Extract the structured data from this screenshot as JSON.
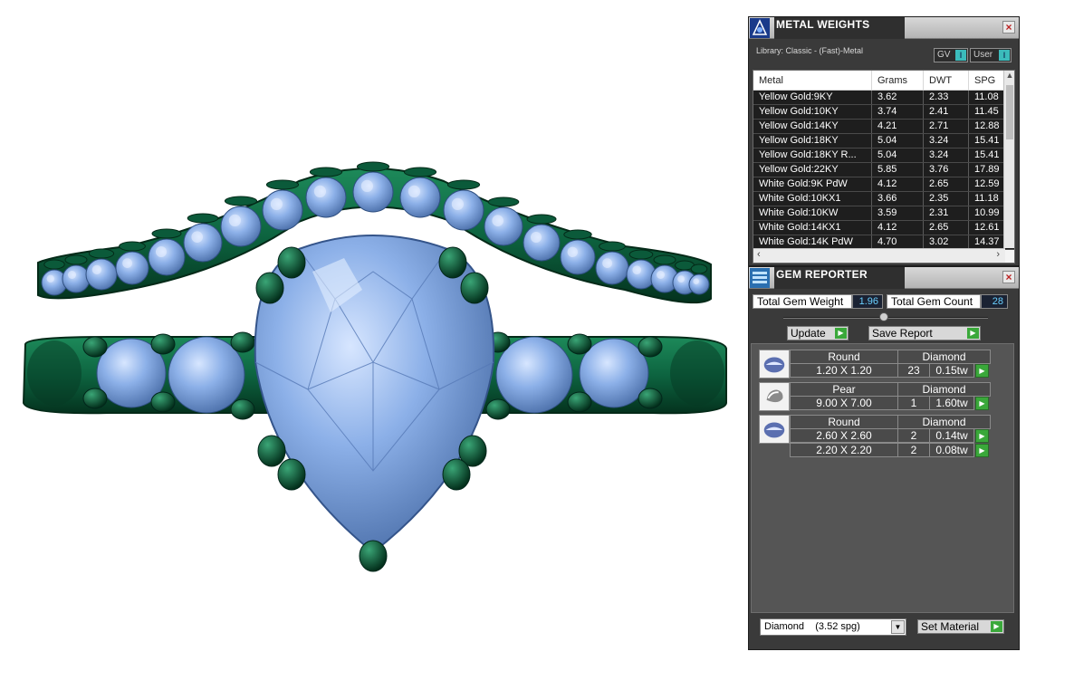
{
  "metal_weights": {
    "title": "METAL WEIGHTS",
    "library": "Library: Classic - (Fast)-Metal",
    "toggle_gv": "GV",
    "toggle_user": "User",
    "knob_glyph": "I",
    "columns": [
      "Metal",
      "Grams",
      "DWT",
      "SPG"
    ],
    "rows": [
      [
        "Yellow Gold:9KY",
        "3.62",
        "2.33",
        "11.08"
      ],
      [
        "Yellow Gold:10KY",
        "3.74",
        "2.41",
        "11.45"
      ],
      [
        "Yellow Gold:14KY",
        "4.21",
        "2.71",
        "12.88"
      ],
      [
        "Yellow Gold:18KY",
        "5.04",
        "3.24",
        "15.41"
      ],
      [
        "Yellow Gold:18KY R...",
        "5.04",
        "3.24",
        "15.41"
      ],
      [
        "Yellow Gold:22KY",
        "5.85",
        "3.76",
        "17.89"
      ],
      [
        "White Gold:9K PdW",
        "4.12",
        "2.65",
        "12.59"
      ],
      [
        "White Gold:10KX1",
        "3.66",
        "2.35",
        "11.18"
      ],
      [
        "White Gold:10KW",
        "3.59",
        "2.31",
        "10.99"
      ],
      [
        "White Gold:14KX1",
        "4.12",
        "2.65",
        "12.61"
      ],
      [
        "White Gold:14K PdW",
        "4.70",
        "3.02",
        "14.37"
      ]
    ]
  },
  "gem_reporter": {
    "title": "GEM REPORTER",
    "total_weight_label": "Total Gem Weight",
    "total_weight_value": "1.96",
    "total_count_label": "Total Gem Count",
    "total_count_value": "28",
    "update_label": "Update",
    "save_report_label": "Save Report",
    "gems": [
      {
        "cut": "Round",
        "material": "Diamond",
        "rows": [
          {
            "size": "1.20 X 1.20",
            "count": "23",
            "weight": "0.15tw"
          }
        ]
      },
      {
        "cut": "Pear",
        "material": "Diamond",
        "rows": [
          {
            "size": "9.00 X 7.00",
            "count": "1",
            "weight": "1.60tw"
          }
        ]
      },
      {
        "cut": "Round",
        "material": "Diamond",
        "rows": [
          {
            "size": "2.60 X 2.60",
            "count": "2",
            "weight": "0.14tw"
          },
          {
            "size": "2.20 X 2.20",
            "count": "2",
            "weight": "0.08tw"
          }
        ]
      }
    ],
    "material_select": "Diamond    (3.52 spg)",
    "set_material_label": "Set Material"
  },
  "colors": {
    "metal": "#0f6b45",
    "metal_dark": "#063a24",
    "gem": "#7fa6e0",
    "gem_light": "#c9dcfb",
    "gem_dark": "#4b6fa8",
    "play_button": "#3aa83a"
  },
  "icons": [
    "metal-weights-icon",
    "gem-reporter-icon",
    "close-icon",
    "play-icon",
    "dropdown-arrow-icon",
    "gem-thumbnail-icon"
  ]
}
